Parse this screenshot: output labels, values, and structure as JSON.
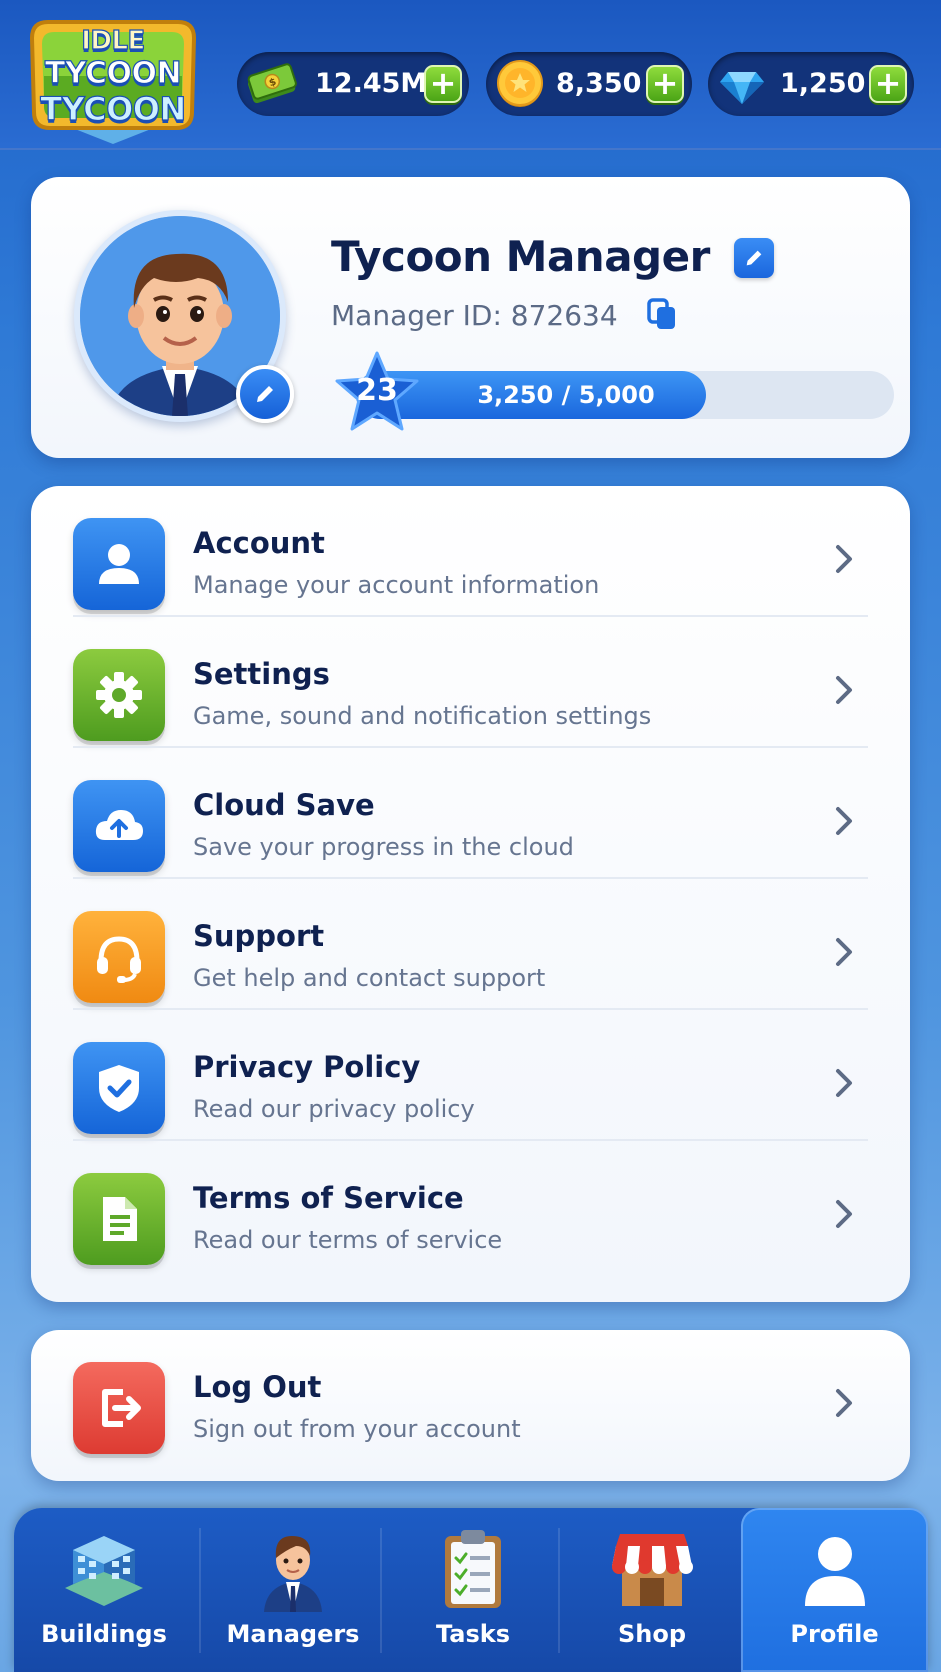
{
  "app": {
    "logo": {
      "line1": "IDLE",
      "line2": "TYCOON",
      "line3": "TYCOON"
    }
  },
  "currencies": {
    "cash": {
      "value": "12.45M",
      "icon": "cash-icon",
      "add_label": "+"
    },
    "coins": {
      "value": "8,350",
      "icon": "coin-icon",
      "add_label": "+"
    },
    "gems": {
      "value": "1,250",
      "icon": "gem-icon",
      "add_label": "+"
    }
  },
  "profile": {
    "name": "Tycoon Manager",
    "id_label": "Manager ID:",
    "id_value": "872634",
    "level": "23",
    "xp_text": "3,250 / 5,000",
    "xp_progress": 0.65
  },
  "menu": [
    {
      "title": "Account",
      "subtitle": "Manage your account information",
      "icon": "user-icon",
      "color": "#1f6fe0"
    },
    {
      "title": "Settings",
      "subtitle": "Game, sound and notification settings",
      "icon": "gear-icon",
      "color": "#5ea92a"
    },
    {
      "title": "Cloud Save",
      "subtitle": "Save your progress in the cloud",
      "icon": "cloud-upload-icon",
      "color": "#1f6fe0"
    },
    {
      "title": "Support",
      "subtitle": "Get help and contact support",
      "icon": "headset-icon",
      "color": "#f39a1e"
    },
    {
      "title": "Privacy Policy",
      "subtitle": "Read our privacy policy",
      "icon": "shield-check-icon",
      "color": "#1f6fe0"
    },
    {
      "title": "Terms of Service",
      "subtitle": "Read our terms of service",
      "icon": "document-icon",
      "color": "#5ea92a"
    }
  ],
  "logout": {
    "title": "Log Out",
    "subtitle": "Sign out from your account",
    "icon": "logout-icon",
    "color": "#e5463c"
  },
  "nav": [
    {
      "label": "Buildings",
      "icon": "building-icon"
    },
    {
      "label": "Managers",
      "icon": "manager-icon"
    },
    {
      "label": "Tasks",
      "icon": "clipboard-icon"
    },
    {
      "label": "Shop",
      "icon": "shop-icon"
    },
    {
      "label": "Profile",
      "icon": "profile-icon",
      "active": true
    }
  ]
}
